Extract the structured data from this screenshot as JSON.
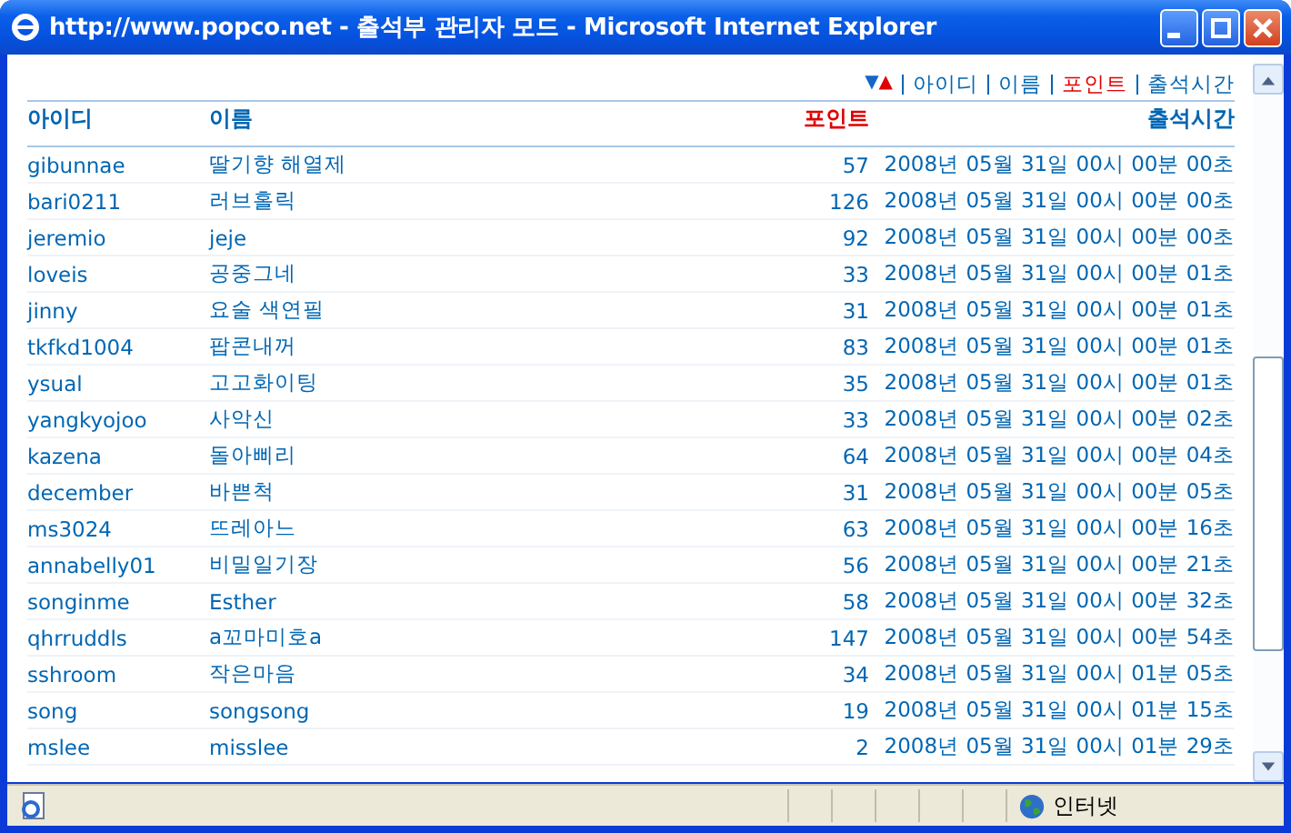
{
  "window": {
    "title": "http://www.popco.net - 출석부 관리자 모드 - Microsoft Internet Explorer"
  },
  "sort_order": {
    "descending": "▼",
    "ascending": "▲"
  },
  "sort_links": [
    {
      "label": "아이디",
      "selected": false
    },
    {
      "label": "이름",
      "selected": false
    },
    {
      "label": "포인트",
      "selected": true
    },
    {
      "label": "출석시간",
      "selected": false
    }
  ],
  "table": {
    "columns": [
      {
        "label": "아이디",
        "selected": false
      },
      {
        "label": "이름",
        "selected": false
      },
      {
        "label": "포인트",
        "selected": true
      },
      {
        "label": "출석시간",
        "selected": false
      }
    ],
    "rows": [
      [
        "gibunnae",
        "딸기향 해열제",
        "57",
        "2008년 05월 31일 00시 00분 00초"
      ],
      [
        "bari0211",
        "러브홀릭",
        "126",
        "2008년 05월 31일 00시 00분 00초"
      ],
      [
        "jeremio",
        "jeje",
        "92",
        "2008년 05월 31일 00시 00분 00초"
      ],
      [
        "loveis",
        "공중그네",
        "33",
        "2008년 05월 31일 00시 00분 01초"
      ],
      [
        "jinny",
        "요술 색연필",
        "31",
        "2008년 05월 31일 00시 00분 01초"
      ],
      [
        "tkfkd1004",
        "팝콘내꺼",
        "83",
        "2008년 05월 31일 00시 00분 01초"
      ],
      [
        "ysual",
        "고고화이팅",
        "35",
        "2008년 05월 31일 00시 00분 01초"
      ],
      [
        "yangkyojoo",
        "사악신",
        "33",
        "2008년 05월 31일 00시 00분 02초"
      ],
      [
        "kazena",
        "돌아삐리",
        "64",
        "2008년 05월 31일 00시 00분 04초"
      ],
      [
        "december",
        "바쁜척",
        "31",
        "2008년 05월 31일 00시 00분 05초"
      ],
      [
        "ms3024",
        "뜨레아느",
        "63",
        "2008년 05월 31일 00시 00분 16초"
      ],
      [
        "annabelly01",
        "비밀일기장",
        "56",
        "2008년 05월 31일 00시 00분 21초"
      ],
      [
        "songinme",
        "Esther",
        "58",
        "2008년 05월 31일 00시 00분 32초"
      ],
      [
        "qhrruddls",
        "a꼬마미호a",
        "147",
        "2008년 05월 31일 00시 00분 54초"
      ],
      [
        "sshroom",
        "작은마음",
        "34",
        "2008년 05월 31일 00시 01분 05초"
      ],
      [
        "song",
        "songsong",
        "19",
        "2008년 05월 31일 00시 01분 15초"
      ],
      [
        "mslee",
        "misslee",
        "2",
        "2008년 05월 31일 00시 01분 29초"
      ]
    ]
  },
  "status_bar": {
    "zone": "인터넷"
  }
}
